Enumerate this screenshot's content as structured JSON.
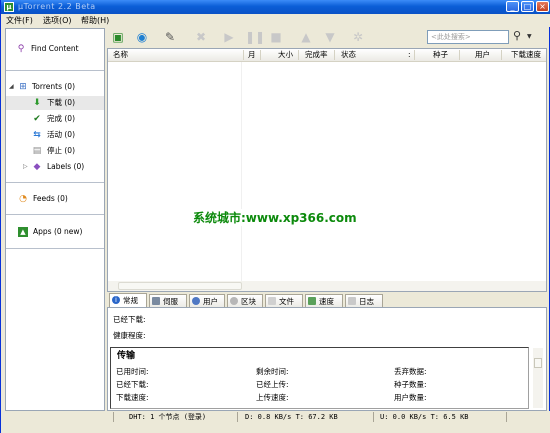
{
  "window": {
    "title": "µTorrent 2.2 Beta",
    "controls": {
      "minimize": "_",
      "maximize": "□",
      "close": "×"
    }
  },
  "menu": [
    "文件(F)",
    "选项(O)",
    "帮助(H)"
  ],
  "sidebar": {
    "find_content": "Find Content",
    "torrents": "Torrents (0)",
    "items": [
      {
        "label": "下载 (0)",
        "icon": "down-arrow-icon"
      },
      {
        "label": "完成 (0)",
        "icon": "check-icon"
      },
      {
        "label": "活动 (0)",
        "icon": "sync-icon"
      },
      {
        "label": "停止 (0)",
        "icon": "stopped-icon"
      }
    ],
    "labels": "Labels (0)",
    "feeds": "Feeds (0)",
    "apps": "Apps (0 new)"
  },
  "toolbar": {
    "search_placeholder": "<此处搜索>",
    "tools": [
      "add-torrent-icon",
      "add-url-icon",
      "create-torrent-icon",
      "remove-icon",
      "start-icon",
      "pause-icon",
      "stop-icon",
      "move-up-icon",
      "move-down-icon",
      "preferences-icon"
    ]
  },
  "list": {
    "columns": [
      "名称",
      "月",
      "大小",
      "完成率",
      "状态",
      ":",
      "种子",
      "用户",
      "下载速度"
    ]
  },
  "watermark": "系统城市:www.xp366.com",
  "tabs": [
    "常规",
    "伺服",
    "用户",
    "区块",
    "文件",
    "速度",
    "日志"
  ],
  "general": {
    "downloaded_label": "已经下载:",
    "availability_label": "健康程度:",
    "transfer_title": "传输",
    "rows": [
      [
        "已用时间:",
        "剩余时间:",
        "丢弃数据:"
      ],
      [
        "已经下载:",
        "已经上传:",
        "种子数量:"
      ],
      [
        "下载速度:",
        "上传速度:",
        "用户数量:"
      ]
    ]
  },
  "status": {
    "dht": "DHT: 1 个节点  (登录)",
    "down": "D: 0.8 KB/s T: 67.2 KB",
    "up": "U: 0.0 KB/s T: 6.5 KB"
  },
  "colors": {
    "accent": "#0b5ed7",
    "watermark": "#0c8a0c"
  }
}
